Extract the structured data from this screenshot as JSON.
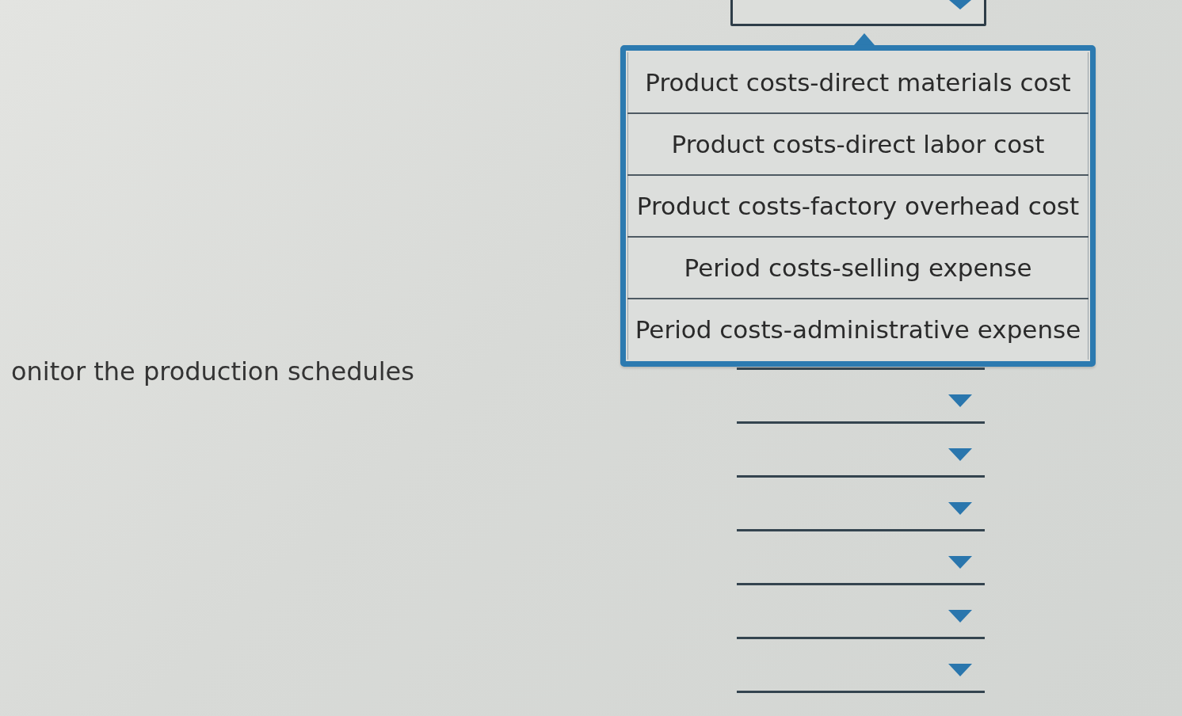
{
  "prompt": {
    "text": "onitor the production schedules"
  },
  "selects": [
    {
      "expanded": true,
      "options": [
        "Product costs-direct materials cost",
        "Product costs-direct labor cost",
        "Product costs-factory overhead cost",
        "Period costs-selling expense",
        "Period costs-administrative expense"
      ]
    },
    {
      "expanded": false
    },
    {
      "expanded": false
    },
    {
      "expanded": false
    },
    {
      "expanded": false
    },
    {
      "expanded": false
    },
    {
      "expanded": false
    }
  ]
}
